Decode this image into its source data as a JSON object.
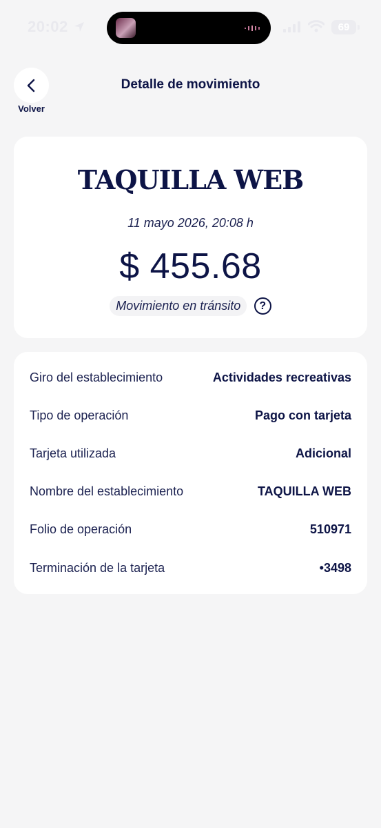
{
  "status_bar": {
    "time": "20:02",
    "battery": "69"
  },
  "header": {
    "back_label": "Volver",
    "title": "Detalle de movimiento"
  },
  "summary": {
    "merchant": "TAQUILLA WEB",
    "date": "11 mayo 2026, 20:08 h",
    "amount": "$ 455.68",
    "status": "Movimiento en tránsito",
    "help_symbol": "?"
  },
  "details": {
    "rows": [
      {
        "label": "Giro del establecimiento",
        "value": "Actividades recreativas"
      },
      {
        "label": "Tipo de operación",
        "value": "Pago con tarjeta"
      },
      {
        "label": "Tarjeta utilizada",
        "value": "Adicional"
      },
      {
        "label": "Nombre del establecimiento",
        "value": "TAQUILLA WEB"
      },
      {
        "label": "Folio de operación",
        "value": "510971"
      },
      {
        "label": "Terminación de la tarjeta",
        "value": "•3498"
      }
    ]
  },
  "colors": {
    "primary": "#0d1446",
    "background": "#f5f5f6",
    "card": "#ffffff"
  },
  "icons": [
    "location-arrow-icon",
    "signal-icon",
    "wifi-icon",
    "battery-icon",
    "chevron-left-icon",
    "question-circle-icon"
  ]
}
